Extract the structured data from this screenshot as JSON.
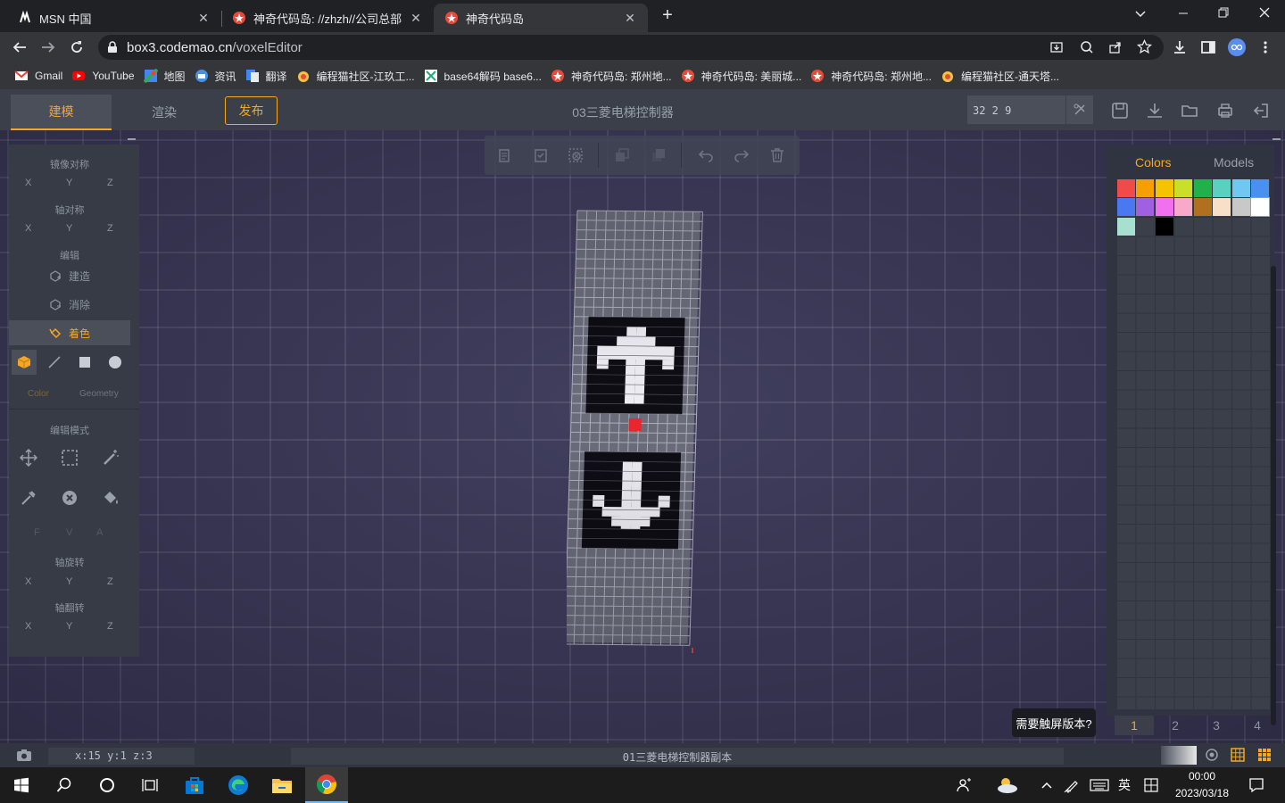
{
  "browser": {
    "tabs": [
      {
        "title": "MSN 中国",
        "active": false
      },
      {
        "title": "神奇代码岛: //zhzh//公司总部",
        "active": false
      },
      {
        "title": "神奇代码岛",
        "active": true
      }
    ],
    "url_host": "box3.codemao.cn",
    "url_path": "/voxelEditor",
    "bookmarks": [
      "Gmail",
      "YouTube",
      "地图",
      "资讯",
      "翻译",
      "编程猫社区-江玖工...",
      "base64解码 base6...",
      "神奇代码岛: 郑州地...",
      "神奇代码岛: 美丽城...",
      "神奇代码岛: 郑州地...",
      "编程猫社区-通天塔..."
    ]
  },
  "app": {
    "modes": {
      "build": "建模",
      "render": "渲染",
      "publish": "发布"
    },
    "project_title": "03三菱电梯控制器",
    "dimensions": "32 2 9",
    "left": {
      "mirror": "镜像对称",
      "axis_sym": "轴对称",
      "edit": "编辑",
      "build": "建造",
      "erase": "消除",
      "paint": "着色",
      "color_tab": "Color",
      "geometry_tab": "Geometry",
      "edit_mode": "编辑模式",
      "fva": [
        "F",
        "V",
        "A"
      ],
      "axis_rotate": "轴旋转",
      "axis_flip": "轴翻转",
      "x": "X",
      "y": "Y",
      "z": "Z"
    },
    "right": {
      "colors_tab": "Colors",
      "models_tab": "Models",
      "palette": [
        "#f04a4a",
        "#f5a000",
        "#f5c400",
        "#c8e02a",
        "#22b04a",
        "#5ad0c0",
        "#70c8f0",
        "#4a90f0",
        "#4a78f0",
        "#a060e0",
        "#f070f0",
        "#f8a8c8",
        "#b07020",
        "#f8e0c8",
        "#c8c8c8",
        "#ffffff",
        "#a8e0d0",
        "#3a3f4a",
        "#000000"
      ],
      "pages": [
        "1",
        "2",
        "3",
        "4"
      ]
    },
    "tip": "需要触屏版本?",
    "coords": "x:15 y:1 z:3",
    "filename": "01三菱电梯控制器副本"
  },
  "taskbar": {
    "lang": "英",
    "time": "00:00",
    "date": "2023/03/18"
  }
}
